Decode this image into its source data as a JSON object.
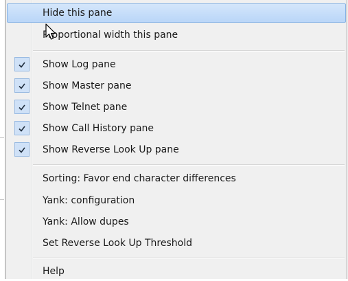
{
  "menu": {
    "items": [
      {
        "label": "Hide this pane",
        "checked": false,
        "highlighted": true
      },
      {
        "label": "Proportional width this pane",
        "checked": false,
        "highlighted": false
      },
      {
        "label": "Show Log pane",
        "checked": true,
        "highlighted": false
      },
      {
        "label": "Show Master pane",
        "checked": true,
        "highlighted": false
      },
      {
        "label": "Show Telnet pane",
        "checked": true,
        "highlighted": false
      },
      {
        "label": "Show Call History pane",
        "checked": true,
        "highlighted": false
      },
      {
        "label": "Show Reverse Look Up pane",
        "checked": true,
        "highlighted": false
      },
      {
        "label": "Sorting: Favor end character differences",
        "checked": false,
        "highlighted": false
      },
      {
        "label": "Yank: configuration",
        "checked": false,
        "highlighted": false
      },
      {
        "label": "Yank: Allow dupes",
        "checked": false,
        "highlighted": false
      },
      {
        "label": "Set Reverse Look Up Threshold",
        "checked": false,
        "highlighted": false
      },
      {
        "label": "Help",
        "checked": false,
        "highlighted": false
      }
    ]
  },
  "colors": {
    "highlight": "#bad6f8",
    "check_bg": "#cfe1f7",
    "menu_bg": "#f0f0f0"
  },
  "icons": {
    "check": "check-icon",
    "cursor": "mouse-pointer-icon"
  }
}
